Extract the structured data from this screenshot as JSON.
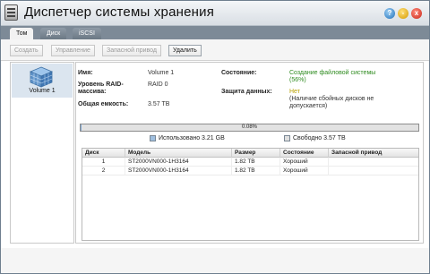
{
  "window": {
    "title": "Диспетчер системы хранения"
  },
  "titlebar_buttons": {
    "help": "?",
    "minimize": "-",
    "close": "x"
  },
  "tabs": [
    {
      "label": "Том",
      "active": true
    },
    {
      "label": "Диск",
      "active": false
    },
    {
      "label": "iSCSI",
      "active": false
    }
  ],
  "toolbar": {
    "create": "Создать",
    "manage": "Управление",
    "spare": "Запасной привод",
    "delete": "Удалить"
  },
  "volumes": [
    {
      "label": "Volume 1",
      "icon": "cube-volume-icon"
    }
  ],
  "details": {
    "name_label": "Имя:",
    "name_value": "Volume 1",
    "raid_label_1": "Уровень RAID-",
    "raid_label_2": "массива:",
    "raid_value": "RAID 0",
    "capacity_label": "Общая емкость:",
    "capacity_value": "3.57 TB",
    "state_label": "Состояние:",
    "state_value_1": "Создание файловой системы",
    "state_value_2": "(56%)",
    "protection_label": "Защита данных:",
    "protection_value_1": "Нет",
    "protection_value_2": "(Наличие сбойных дисков не",
    "protection_value_3": "допускается)"
  },
  "usage": {
    "percent_text": "0.08%",
    "used_fraction": 0.0008,
    "used_label": "Использовано 3.21 GB",
    "free_label": "Свободно 3.57 TB"
  },
  "disk_table": {
    "columns": [
      "Диск",
      "Модель",
      "Размер",
      "Состояние",
      "Запасной привод"
    ],
    "rows": [
      [
        "1",
        "ST2000VN000-1H3164",
        "1.82 TB",
        "Хороший",
        ""
      ],
      [
        "2",
        "ST2000VN000-1H3164",
        "1.82 TB",
        "Хороший",
        ""
      ]
    ]
  },
  "colors": {
    "tabbar": "#7d8a97",
    "selected_volume": "#dbe5ef",
    "status_green": "#2e8b1f",
    "status_yellow": "#b9a000",
    "used_legend": "#9fbfe0",
    "free_legend": "#e0e0e0"
  }
}
